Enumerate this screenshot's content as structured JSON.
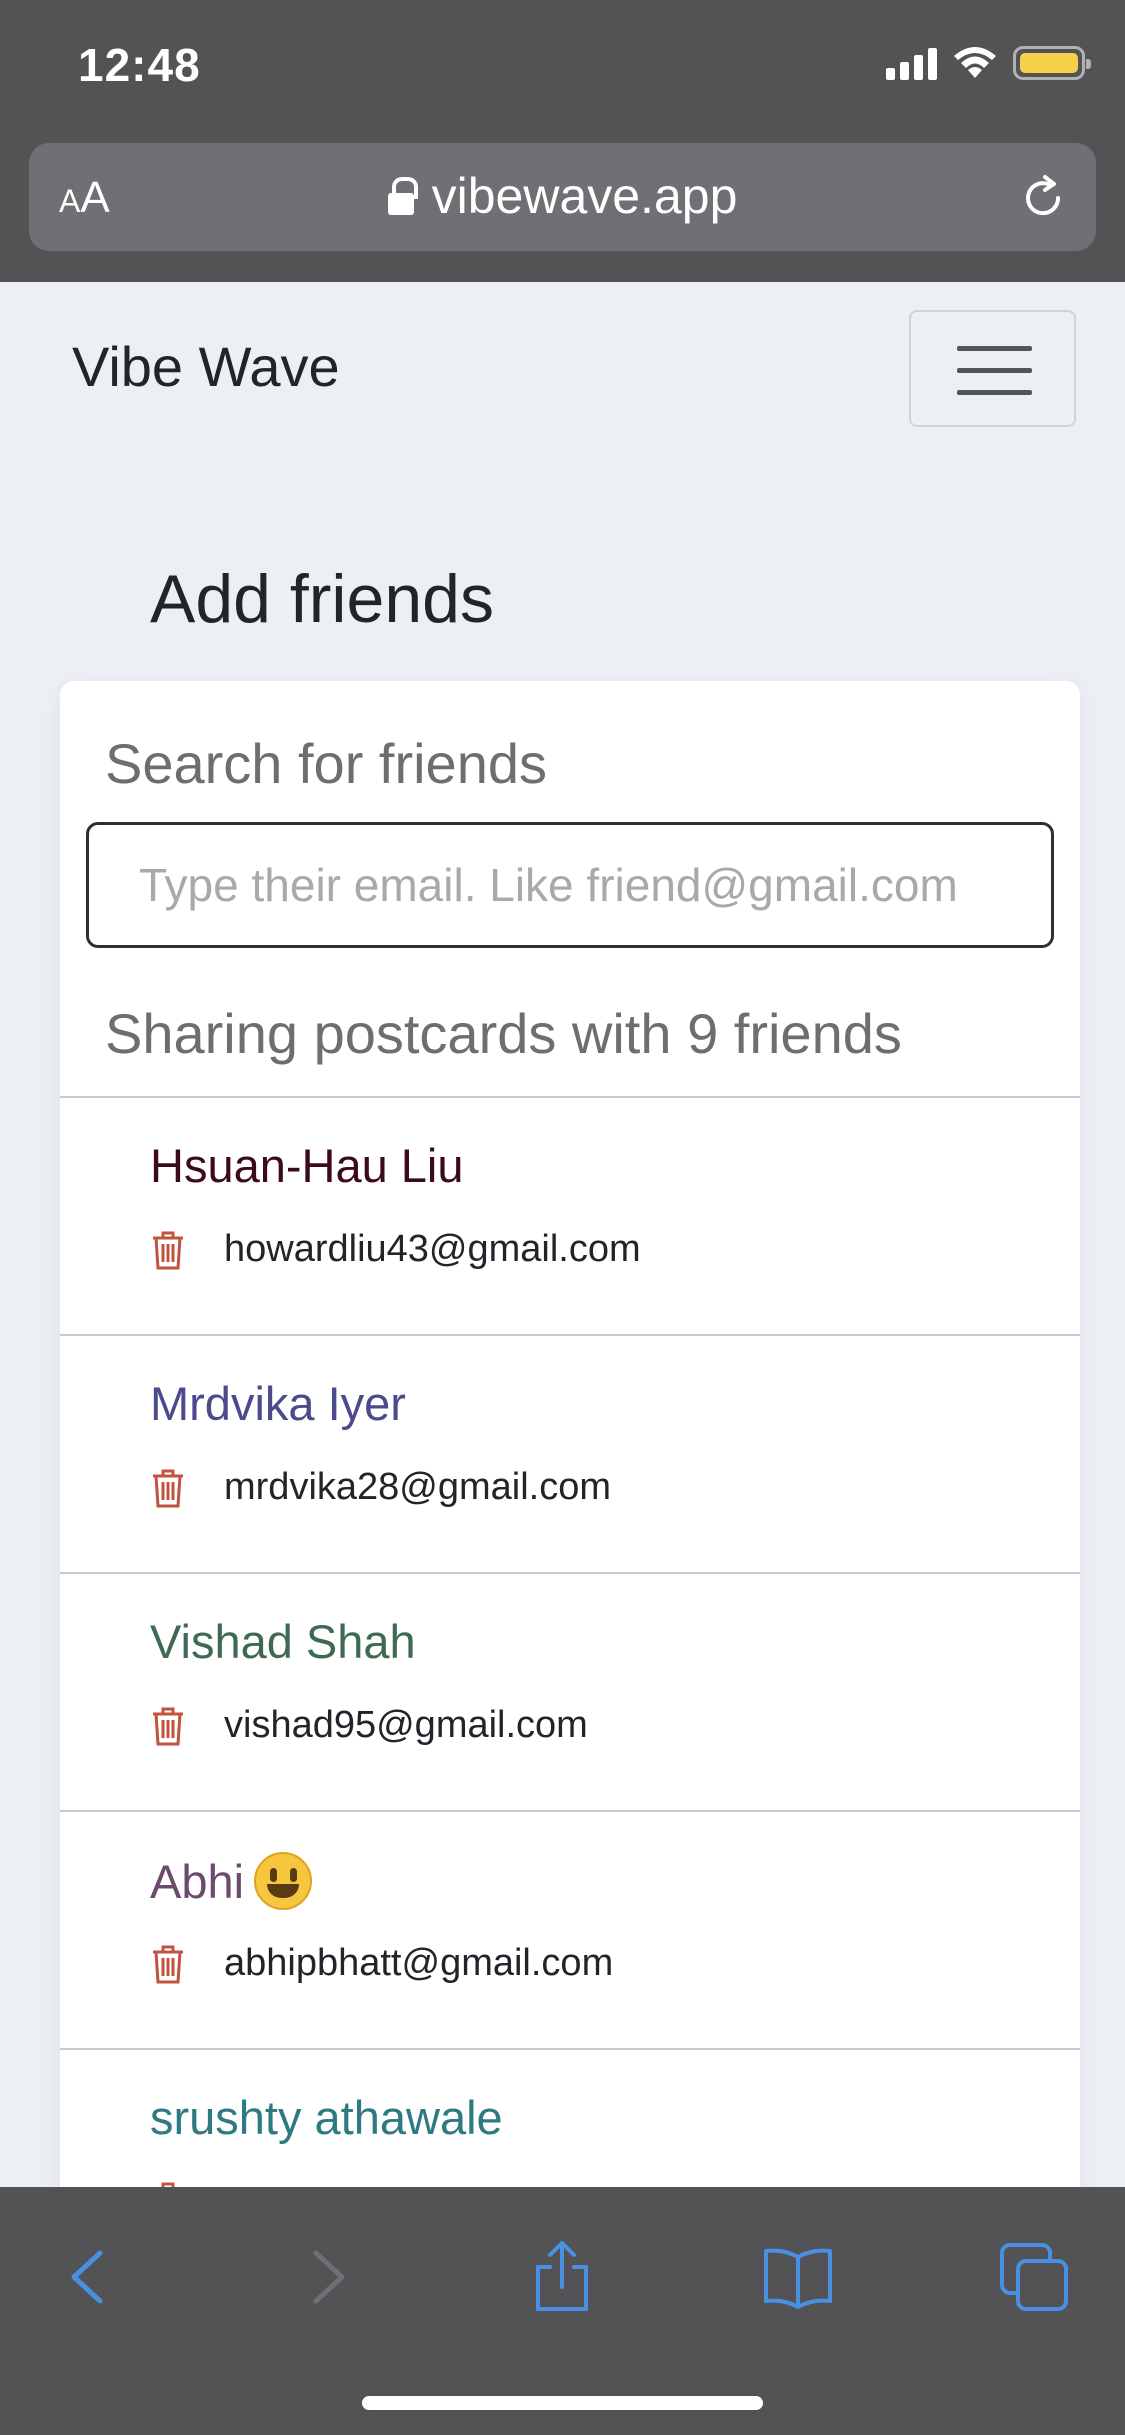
{
  "status_bar": {
    "time": "12:48"
  },
  "browser": {
    "text_size_label": "AA",
    "url": "vibewave.app"
  },
  "app": {
    "brand": "Vibe Wave"
  },
  "page": {
    "title": "Add friends",
    "search_heading": "Search for friends",
    "search_placeholder": "Type their email. Like friend@gmail.com",
    "count_heading": "Sharing postcards with 9 friends"
  },
  "friends": [
    {
      "name": "Hsuan-Hau Liu",
      "email": "howardliu43@gmail.com",
      "color": "#3b0b17"
    },
    {
      "name": "Mrdvika Iyer",
      "email": "mrdvika28@gmail.com",
      "color": "#4a4a8c"
    },
    {
      "name": "Vishad Shah",
      "email": "vishad95@gmail.com",
      "color": "#3f6a52"
    },
    {
      "name": "Abhi",
      "email": "abhipbhatt@gmail.com",
      "color": "#6b4a6e",
      "emoji": "grinning-face"
    },
    {
      "name": "srushty athawale",
      "email": "",
      "color": "#2e7a83"
    }
  ],
  "colors": {
    "trash_icon": "#c0543f",
    "toolbar_accent": "#4a90e2"
  }
}
